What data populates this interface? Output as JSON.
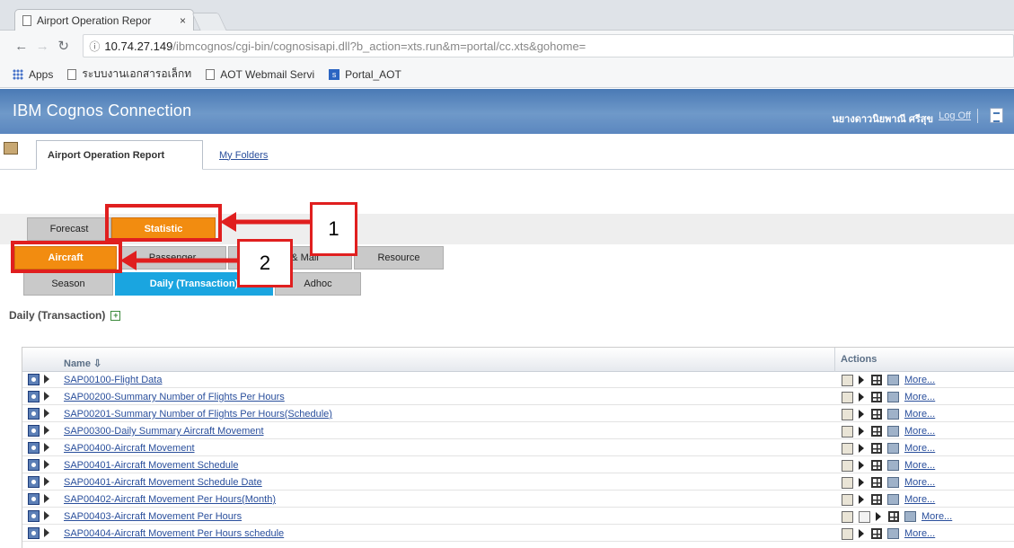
{
  "browser": {
    "tab_title": "Airport Operation Repor",
    "tab_close": "×",
    "url_host": "10.74.27.149",
    "url_path": "/ibmcognos/cgi-bin/cognosisapi.dll?b_action=xts.run&m=portal/cc.xts&gohome=",
    "bookmarks": [
      "Apps",
      "ระบบงานเอกสารอเล็กท",
      "AOT Webmail Servi",
      "Portal_AOT"
    ]
  },
  "cognos": {
    "title": "IBM Cognos Connection",
    "user": "นยางดาวนิยพาณี ศรีสุข",
    "logoff": "Log Off"
  },
  "portal_tabs": [
    "Airport Operation Report",
    "My Folders"
  ],
  "nav": {
    "row1": [
      "Forecast",
      "Statistic"
    ],
    "row2": [
      "Aircraft",
      "Passenger",
      "Cargo & Mail",
      "Resource"
    ],
    "row3": [
      "Season",
      "Daily (Transaction)",
      "Adhoc"
    ]
  },
  "callouts": [
    "1",
    "2"
  ],
  "section_title": "Daily (Transaction)",
  "section_expand": "+",
  "list": {
    "header_name": "Name ⇩",
    "header_actions": "Actions",
    "more_label": "More...",
    "reports": [
      "SAP00100-Flight Data",
      "SAP00200-Summary Number of Flights Per Hours",
      "SAP00201-Summary Number of Flights Per Hours(Schedule)",
      "SAP00300-Daily Summary Aircraft Movement",
      "SAP00400-Aircraft Movement",
      "SAP00401-Aircraft Movement Schedule",
      "SAP00401-Aircraft Movement Schedule Date",
      "SAP00402-Aircraft Movement Per Hours(Month)",
      "SAP00403-Aircraft Movement Per Hours",
      "SAP00404-Aircraft Movement Per Hours schedule"
    ]
  },
  "colors": {
    "orange": "#f28c10",
    "blue": "#1aa5e0",
    "callout_red": "#e01f1f",
    "cognos_bar": "#5b87bf"
  }
}
